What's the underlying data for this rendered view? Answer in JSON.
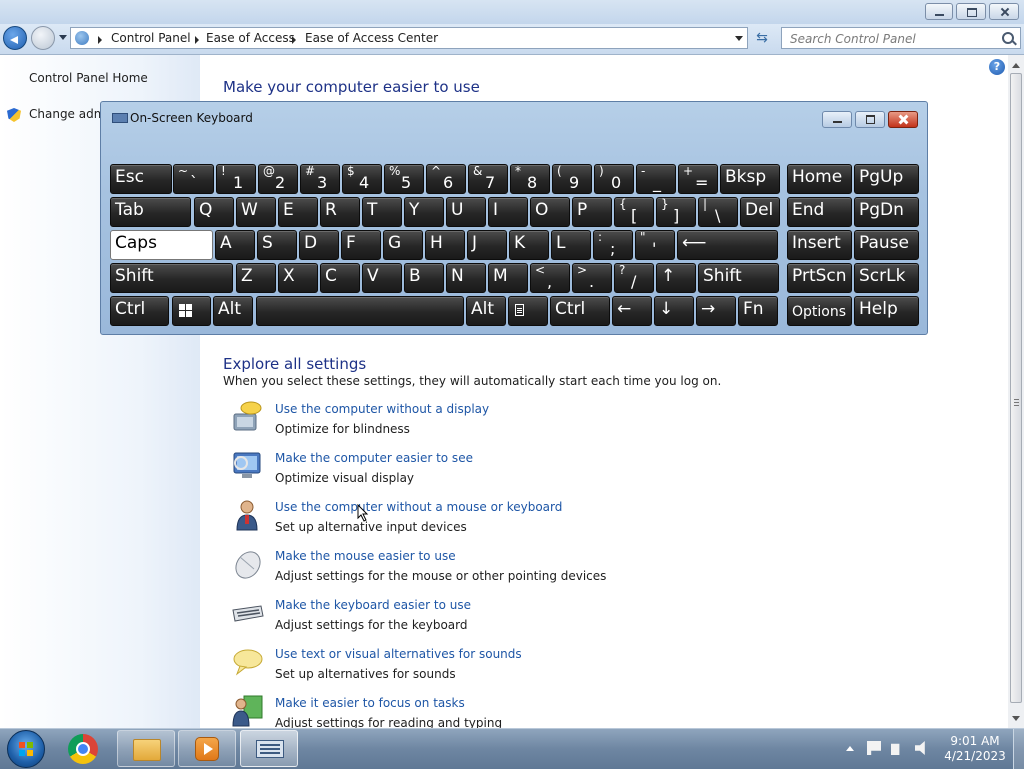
{
  "window": {
    "title": "Ease of Access Center"
  },
  "address": {
    "breadcrumbs": [
      "Control Panel",
      "Ease of Access",
      "Ease of Access Center"
    ]
  },
  "search": {
    "placeholder": "Search Control Panel"
  },
  "left_pane": {
    "home": "Control Panel Home",
    "admin_link": "Change admi"
  },
  "main": {
    "title": "Make your computer easier to use",
    "explore": {
      "title": "Explore all settings",
      "description": "When you select these settings, they will automatically start each time you log on.",
      "items": [
        {
          "link": "Use the computer without a display",
          "desc": "Optimize for blindness",
          "icon": "narrator-icon"
        },
        {
          "link": "Make the computer easier to see",
          "desc": "Optimize visual display",
          "icon": "monitor-icon"
        },
        {
          "link": "Use the computer without a mouse or keyboard",
          "desc": "Set up alternative input devices",
          "icon": "user-icon"
        },
        {
          "link": "Make the mouse easier to use",
          "desc": "Adjust settings for the mouse or other pointing devices",
          "icon": "mouse-icon"
        },
        {
          "link": "Make the keyboard easier to use",
          "desc": "Adjust settings for the keyboard",
          "icon": "keyboard-icon"
        },
        {
          "link": "Use text or visual alternatives for sounds",
          "desc": "Set up alternatives for sounds",
          "icon": "speech-bubble-icon"
        },
        {
          "link": "Make it easier to focus on tasks",
          "desc": "Adjust settings for reading and typing",
          "icon": "focus-icon"
        }
      ]
    }
  },
  "osk": {
    "title": "On-Screen Keyboard",
    "rows": [
      [
        {
          "label": "Esc"
        },
        {
          "shift": "~",
          "main": "`"
        },
        {
          "shift": "!",
          "main": "1"
        },
        {
          "shift": "@",
          "main": "2"
        },
        {
          "shift": "#",
          "main": "3"
        },
        {
          "shift": "$",
          "main": "4"
        },
        {
          "shift": "%",
          "main": "5"
        },
        {
          "shift": "^",
          "main": "6"
        },
        {
          "shift": "&",
          "main": "7"
        },
        {
          "shift": "*",
          "main": "8"
        },
        {
          "shift": "(",
          "main": "9"
        },
        {
          "shift": ")",
          "main": "0"
        },
        {
          "shift": "-",
          "main": "_"
        },
        {
          "shift": "+",
          "main": "="
        },
        {
          "label": "Bksp"
        },
        {
          "label": "Home"
        },
        {
          "label": "PgUp"
        }
      ],
      [
        {
          "label": "Tab"
        },
        {
          "label": "Q"
        },
        {
          "label": "W"
        },
        {
          "label": "E"
        },
        {
          "label": "R"
        },
        {
          "label": "T"
        },
        {
          "label": "Y"
        },
        {
          "label": "U"
        },
        {
          "label": "I"
        },
        {
          "label": "O"
        },
        {
          "label": "P"
        },
        {
          "shift": "{",
          "main": "["
        },
        {
          "shift": "}",
          "main": "]"
        },
        {
          "shift": "|",
          "main": "\\"
        },
        {
          "label": "Del"
        },
        {
          "label": "End"
        },
        {
          "label": "PgDn"
        }
      ],
      [
        {
          "label": "Caps"
        },
        {
          "label": "A"
        },
        {
          "label": "S"
        },
        {
          "label": "D"
        },
        {
          "label": "F"
        },
        {
          "label": "G"
        },
        {
          "label": "H"
        },
        {
          "label": "J"
        },
        {
          "label": "K"
        },
        {
          "label": "L"
        },
        {
          "shift": ":",
          "main": ";"
        },
        {
          "shift": "\"",
          "main": "'"
        },
        {
          "label": "⟵"
        },
        {
          "label": "Insert"
        },
        {
          "label": "Pause"
        }
      ],
      [
        {
          "label": "Shift"
        },
        {
          "label": "Z"
        },
        {
          "label": "X"
        },
        {
          "label": "C"
        },
        {
          "label": "V"
        },
        {
          "label": "B"
        },
        {
          "label": "N"
        },
        {
          "label": "M"
        },
        {
          "shift": "<",
          "main": ","
        },
        {
          "shift": ">",
          "main": "."
        },
        {
          "shift": "?",
          "main": "/"
        },
        {
          "label": "↑"
        },
        {
          "label": "Shift"
        },
        {
          "label": "PrtScn"
        },
        {
          "label": "ScrLk"
        }
      ],
      [
        {
          "label": "Ctrl"
        },
        {
          "label": ""
        },
        {
          "label": "Alt"
        },
        {
          "label": ""
        },
        {
          "label": "Alt"
        },
        {
          "label": ""
        },
        {
          "label": "Ctrl"
        },
        {
          "label": "←"
        },
        {
          "label": "↓"
        },
        {
          "label": "→"
        },
        {
          "label": "Fn"
        },
        {
          "label": "Options"
        },
        {
          "label": "Help"
        }
      ]
    ]
  },
  "taskbar": {
    "time": "9:01 AM",
    "date": "4/21/2023"
  }
}
